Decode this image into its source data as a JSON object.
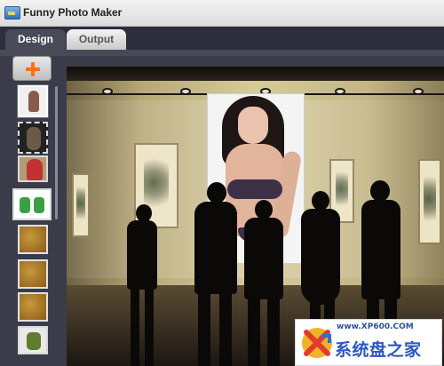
{
  "window": {
    "title": "Funny Photo Maker",
    "icon": "app-picture-icon"
  },
  "tabs": [
    {
      "label": "Design",
      "active": true
    },
    {
      "label": "Output",
      "active": false
    }
  ],
  "sidebar": {
    "add_button_icon": "plus-icon",
    "thumbnails": [
      {
        "type": "frame",
        "content": "portrait-photo",
        "selected": true
      },
      {
        "type": "frame",
        "content": "film-strip-portrait"
      },
      {
        "type": "frame",
        "content": "woman-red-top"
      },
      {
        "type": "frame",
        "content": "cartoon-figures"
      },
      {
        "type": "frame",
        "content": "gold-texture"
      },
      {
        "type": "frame",
        "content": "gold-texture"
      },
      {
        "type": "frame",
        "content": "gold-texture"
      },
      {
        "type": "frame",
        "content": "nature-scene"
      }
    ]
  },
  "canvas": {
    "content": "gallery-scene-with-poster"
  },
  "watermark": {
    "url": "www.XP600.COM",
    "name": "系统盘之家"
  },
  "colors": {
    "background": "#2e2d3c",
    "panel": "#3c3b4a",
    "active_tab": "#4a4958",
    "accent_plus": "#ff6f14",
    "watermark_text": "#2b56c5"
  }
}
